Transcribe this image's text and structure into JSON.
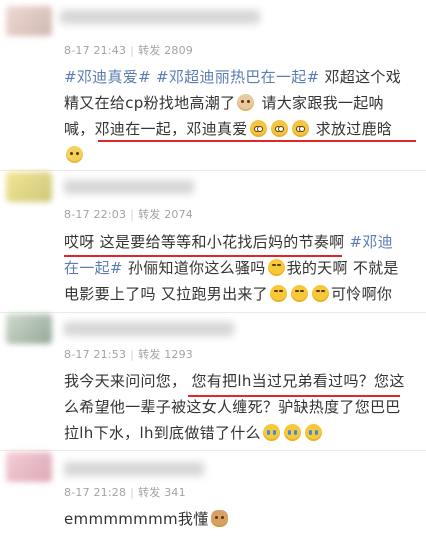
{
  "comments": [
    {
      "time": "8-17 21:43",
      "separator": "|",
      "forward_label": "转发",
      "forward_count": "2809",
      "lines": [
        [
          {
            "t": "tag",
            "v": "#邓迪真爱#"
          },
          {
            "t": "tag",
            "v": " #邓超迪丽热巴在一起#"
          },
          {
            "t": "text",
            "v": "  邓超这个戏"
          }
        ],
        [
          {
            "t": "text",
            "v": "精又在给cp粉找地高潮了"
          },
          {
            "t": "emoji",
            "v": "face"
          },
          {
            "t": "text",
            "v": " 请大家跟我一起呐"
          }
        ],
        [
          {
            "t": "text",
            "v": "喊，邓迪在一起，邓迪真爱"
          },
          {
            "t": "emoji",
            "v": "shock"
          },
          {
            "t": "emoji",
            "v": "shock"
          },
          {
            "t": "emoji",
            "v": "shock"
          },
          {
            "t": "text",
            "v": " 求放过鹿晗"
          }
        ],
        [
          {
            "t": "emoji",
            "v": "meh"
          }
        ]
      ]
    },
    {
      "time": "8-17 22:03",
      "separator": "|",
      "forward_label": "转发",
      "forward_count": "2074",
      "lines": [
        [
          {
            "t": "text",
            "v": "哎呀 这是要给等等和小花找后妈的节奏啊 "
          },
          {
            "t": "tag",
            "v": "#邓迪"
          }
        ],
        [
          {
            "t": "tag",
            "v": "在一起#"
          },
          {
            "t": "text",
            "v": "  孙俪知道你这么骚吗"
          },
          {
            "t": "emoji",
            "v": "laugh"
          },
          {
            "t": "text",
            "v": "我的天啊 不就是"
          }
        ],
        [
          {
            "t": "text",
            "v": "电影要上了吗 又拉跑男出来了"
          },
          {
            "t": "emoji",
            "v": "laugh"
          },
          {
            "t": "emoji",
            "v": "laugh"
          },
          {
            "t": "emoji",
            "v": "laugh"
          },
          {
            "t": "text",
            "v": "可怜啊你"
          }
        ]
      ]
    },
    {
      "time": "8-17 21:53",
      "separator": "|",
      "forward_label": "转发",
      "forward_count": "1293",
      "lines": [
        [
          {
            "t": "text",
            "v": "我今天来问问您，  您有把lh当过兄弟看过吗？您这"
          }
        ],
        [
          {
            "t": "text",
            "v": "么希望他一辈子被这女人缠死？驴缺热度了您巴巴"
          }
        ],
        [
          {
            "t": "text",
            "v": "拉lh下水，lh到底做错了什么"
          },
          {
            "t": "emoji",
            "v": "cry"
          },
          {
            "t": "emoji",
            "v": "cry"
          },
          {
            "t": "emoji",
            "v": "cry"
          }
        ]
      ]
    },
    {
      "time": "8-17 21:28",
      "separator": "|",
      "forward_label": "转发",
      "forward_count": "341",
      "lines": [
        [
          {
            "t": "text",
            "v": "emmmmmmm我懂"
          },
          {
            "t": "emoji",
            "v": "cat"
          }
        ]
      ]
    }
  ],
  "colors": {
    "hashtag": "#5a7eb3",
    "underline": "#e0262b",
    "meta": "#a3a3a3",
    "text": "#333333"
  }
}
